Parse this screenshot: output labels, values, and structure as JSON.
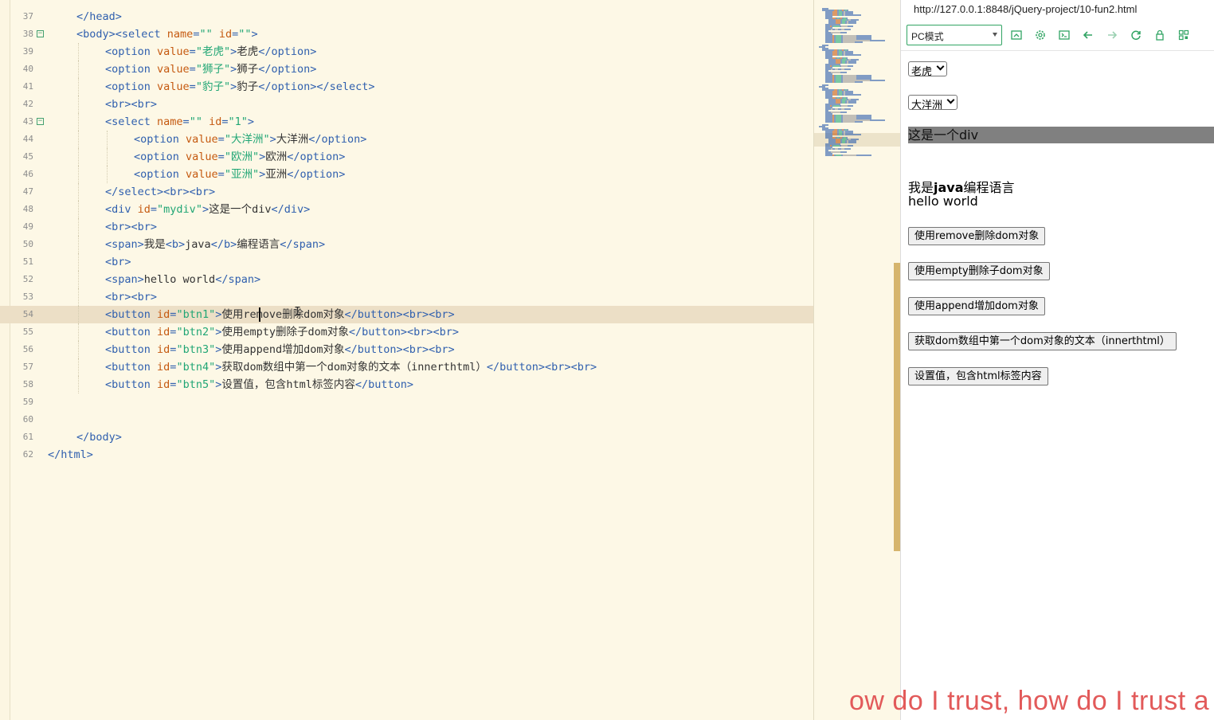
{
  "editor": {
    "lines": [
      {
        "n": "37",
        "fold": false,
        "indent": 1,
        "tokens": [
          [
            "tag",
            "</head>"
          ]
        ]
      },
      {
        "n": "38",
        "fold": true,
        "indent": 1,
        "tokens": [
          [
            "tag",
            "<body><select "
          ],
          [
            "attr",
            "name"
          ],
          [
            "tag",
            "="
          ],
          [
            "str",
            "\"\""
          ],
          [
            "tag",
            " "
          ],
          [
            "attr",
            "id"
          ],
          [
            "tag",
            "="
          ],
          [
            "str",
            "\"\""
          ],
          [
            "tag",
            ">"
          ]
        ]
      },
      {
        "n": "39",
        "fold": false,
        "indent": 2,
        "tokens": [
          [
            "tag",
            "<option "
          ],
          [
            "attr",
            "value"
          ],
          [
            "tag",
            "="
          ],
          [
            "str",
            "\"老虎\""
          ],
          [
            "tag",
            ">"
          ],
          [
            "txt",
            "老虎"
          ],
          [
            "tag",
            "</option>"
          ]
        ]
      },
      {
        "n": "40",
        "fold": false,
        "indent": 2,
        "tokens": [
          [
            "tag",
            "<option "
          ],
          [
            "attr",
            "value"
          ],
          [
            "tag",
            "="
          ],
          [
            "str",
            "\"狮子\""
          ],
          [
            "tag",
            ">"
          ],
          [
            "txt",
            "狮子"
          ],
          [
            "tag",
            "</option>"
          ]
        ]
      },
      {
        "n": "41",
        "fold": false,
        "indent": 2,
        "tokens": [
          [
            "tag",
            "<option "
          ],
          [
            "attr",
            "value"
          ],
          [
            "tag",
            "="
          ],
          [
            "str",
            "\"豹子\""
          ],
          [
            "tag",
            ">"
          ],
          [
            "txt",
            "豹子"
          ],
          [
            "tag",
            "</option></select>"
          ]
        ]
      },
      {
        "n": "42",
        "fold": false,
        "indent": 2,
        "tokens": [
          [
            "tag",
            "<br><br>"
          ]
        ]
      },
      {
        "n": "43",
        "fold": true,
        "indent": 2,
        "tokens": [
          [
            "tag",
            "<select "
          ],
          [
            "attr",
            "name"
          ],
          [
            "tag",
            "="
          ],
          [
            "str",
            "\"\""
          ],
          [
            "tag",
            " "
          ],
          [
            "attr",
            "id"
          ],
          [
            "tag",
            "="
          ],
          [
            "str",
            "\"1\""
          ],
          [
            "tag",
            ">"
          ]
        ]
      },
      {
        "n": "44",
        "fold": false,
        "indent": 3,
        "tokens": [
          [
            "tag",
            "<option "
          ],
          [
            "attr",
            "value"
          ],
          [
            "tag",
            "="
          ],
          [
            "str",
            "\"大洋洲\""
          ],
          [
            "tag",
            ">"
          ],
          [
            "txt",
            "大洋洲"
          ],
          [
            "tag",
            "</option>"
          ]
        ]
      },
      {
        "n": "45",
        "fold": false,
        "indent": 3,
        "tokens": [
          [
            "tag",
            "<option "
          ],
          [
            "attr",
            "value"
          ],
          [
            "tag",
            "="
          ],
          [
            "str",
            "\"欧洲\""
          ],
          [
            "tag",
            ">"
          ],
          [
            "txt",
            "欧洲"
          ],
          [
            "tag",
            "</option>"
          ]
        ]
      },
      {
        "n": "46",
        "fold": false,
        "indent": 3,
        "tokens": [
          [
            "tag",
            "<option "
          ],
          [
            "attr",
            "value"
          ],
          [
            "tag",
            "="
          ],
          [
            "str",
            "\"亚洲\""
          ],
          [
            "tag",
            ">"
          ],
          [
            "txt",
            "亚洲"
          ],
          [
            "tag",
            "</option>"
          ]
        ]
      },
      {
        "n": "47",
        "fold": false,
        "indent": 2,
        "tokens": [
          [
            "tag",
            "</select><br><br>"
          ]
        ]
      },
      {
        "n": "48",
        "fold": false,
        "indent": 2,
        "tokens": [
          [
            "tag",
            "<div "
          ],
          [
            "attr",
            "id"
          ],
          [
            "tag",
            "="
          ],
          [
            "str",
            "\"mydiv\""
          ],
          [
            "tag",
            ">"
          ],
          [
            "txt",
            "这是一个div"
          ],
          [
            "tag",
            "</div>"
          ]
        ]
      },
      {
        "n": "49",
        "fold": false,
        "indent": 2,
        "tokens": [
          [
            "tag",
            "<br><br>"
          ]
        ]
      },
      {
        "n": "50",
        "fold": false,
        "indent": 2,
        "tokens": [
          [
            "tag",
            "<span>"
          ],
          [
            "txt",
            "我是"
          ],
          [
            "tag",
            "<b>"
          ],
          [
            "txt",
            "java"
          ],
          [
            "tag",
            "</b>"
          ],
          [
            "txt",
            "编程语言"
          ],
          [
            "tag",
            "</span>"
          ]
        ]
      },
      {
        "n": "51",
        "fold": false,
        "indent": 2,
        "tokens": [
          [
            "tag",
            "<br>"
          ]
        ]
      },
      {
        "n": "52",
        "fold": false,
        "indent": 2,
        "tokens": [
          [
            "tag",
            "<span>"
          ],
          [
            "txt",
            "hello world"
          ],
          [
            "tag",
            "</span>"
          ]
        ]
      },
      {
        "n": "53",
        "fold": false,
        "indent": 2,
        "tokens": [
          [
            "tag",
            "<br><br>"
          ]
        ]
      },
      {
        "n": "54",
        "fold": false,
        "indent": 2,
        "current": true,
        "tokens": [
          [
            "tag",
            "<button "
          ],
          [
            "attr",
            "id"
          ],
          [
            "tag",
            "="
          ],
          [
            "str",
            "\"btn1\""
          ],
          [
            "tag",
            ">"
          ],
          [
            "txt",
            "使用remove删除dom对象"
          ],
          [
            "tag",
            "</button><br><br>"
          ]
        ]
      },
      {
        "n": "55",
        "fold": false,
        "indent": 2,
        "tokens": [
          [
            "tag",
            "<button "
          ],
          [
            "attr",
            "id"
          ],
          [
            "tag",
            "="
          ],
          [
            "str",
            "\"btn2\""
          ],
          [
            "tag",
            ">"
          ],
          [
            "txt",
            "使用empty删除子dom对象"
          ],
          [
            "tag",
            "</button><br><br>"
          ]
        ]
      },
      {
        "n": "56",
        "fold": false,
        "indent": 2,
        "tokens": [
          [
            "tag",
            "<button "
          ],
          [
            "attr",
            "id"
          ],
          [
            "tag",
            "="
          ],
          [
            "str",
            "\"btn3\""
          ],
          [
            "tag",
            ">"
          ],
          [
            "txt",
            "使用append增加dom对象"
          ],
          [
            "tag",
            "</button><br><br>"
          ]
        ]
      },
      {
        "n": "57",
        "fold": false,
        "indent": 2,
        "tokens": [
          [
            "tag",
            "<button "
          ],
          [
            "attr",
            "id"
          ],
          [
            "tag",
            "="
          ],
          [
            "str",
            "\"btn4\""
          ],
          [
            "tag",
            ">"
          ],
          [
            "txt",
            "获取dom数组中第一个dom对象的文本（innerthtml）"
          ],
          [
            "tag",
            "</button><br><br>"
          ]
        ]
      },
      {
        "n": "58",
        "fold": false,
        "indent": 2,
        "tokens": [
          [
            "tag",
            "<button "
          ],
          [
            "attr",
            "id"
          ],
          [
            "tag",
            "="
          ],
          [
            "str",
            "\"btn5\""
          ],
          [
            "tag",
            ">"
          ],
          [
            "txt",
            "设置值，包含html标签内容"
          ],
          [
            "tag",
            "</button>"
          ]
        ]
      },
      {
        "n": "59",
        "fold": false,
        "indent": 0,
        "tokens": []
      },
      {
        "n": "60",
        "fold": false,
        "indent": 0,
        "tokens": []
      },
      {
        "n": "61",
        "fold": false,
        "indent": 1,
        "tokens": [
          [
            "tag",
            "</body>"
          ]
        ]
      },
      {
        "n": "62",
        "fold": false,
        "indent": 0,
        "tokens": [
          [
            "tag",
            "</html>"
          ]
        ]
      }
    ]
  },
  "preview": {
    "url": "http://127.0.0.1:8848/jQuery-project/10-fun2.html",
    "mode_label": "PC模式",
    "toolbar_icons": [
      "screenshot-icon",
      "settings-icon",
      "console-icon",
      "back-icon",
      "forward-icon",
      "refresh-icon",
      "lock-icon",
      "qrcode-icon"
    ],
    "select1_value": "老虎",
    "select2_value": "大洋洲",
    "mydiv_text": "这是一个div",
    "span1_prefix": "我是",
    "span1_bold": "java",
    "span1_suffix": "编程语言",
    "span2_text": "hello world",
    "buttons": [
      "使用remove删除dom对象",
      "使用empty删除子dom对象",
      "使用append增加dom对象",
      "获取dom数组中第一个dom对象的文本（innerthtml）",
      "设置值，包含html标签内容"
    ]
  },
  "overlay": {
    "lyrics": "ow do I trust, how do I trust a"
  },
  "colors": {
    "tag": "#2f5fae",
    "attr": "#c55a11",
    "string": "#21a675",
    "accent": "#31a463",
    "lyrics": "#e25a5a"
  }
}
